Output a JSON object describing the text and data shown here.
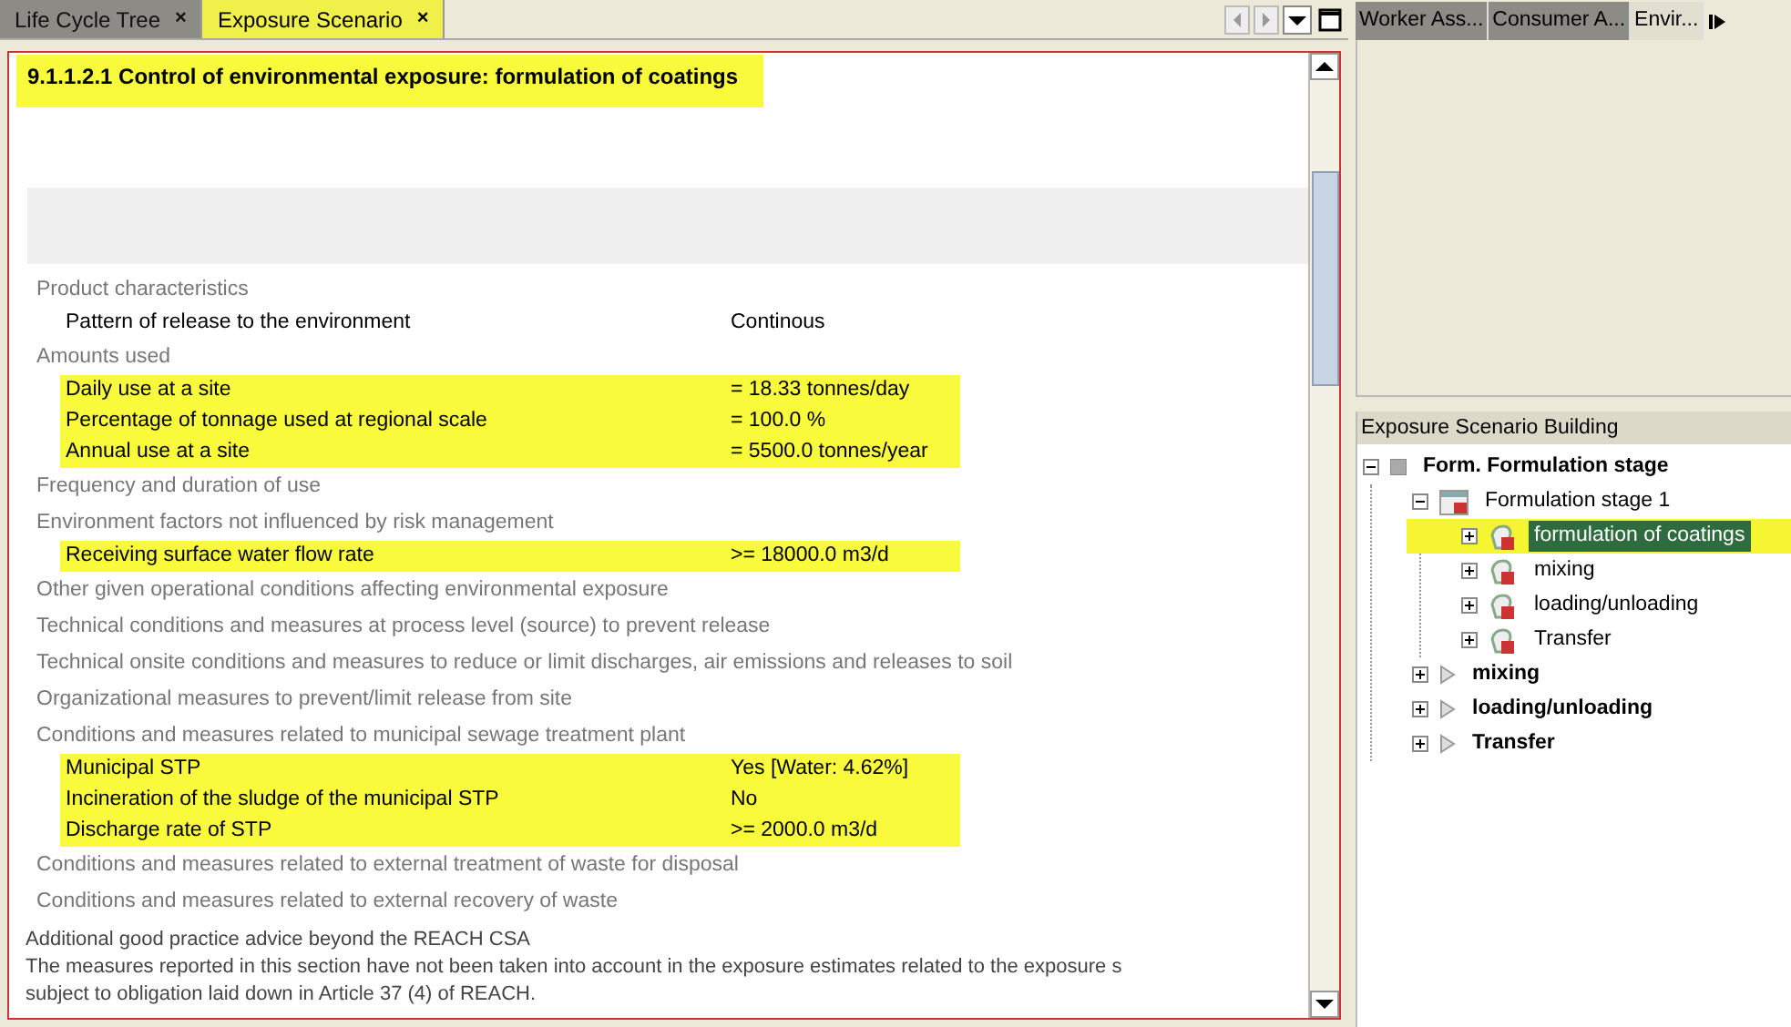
{
  "editor_tabs": [
    {
      "label": "Life Cycle Tree",
      "close": "×",
      "selected": false
    },
    {
      "label": "Exposure Scenario",
      "close": "×",
      "selected": true
    }
  ],
  "document": {
    "title": "9.1.1.2.1 Control of environmental exposure: formulation of coatings",
    "title_highlighted": true,
    "items": [
      {
        "kind": "heading",
        "text": "Product characteristics"
      },
      {
        "kind": "row",
        "label": "Pattern of release to the environment",
        "value": "Continous",
        "highlighted": false
      },
      {
        "kind": "heading",
        "text": "Amounts used"
      },
      {
        "kind": "row",
        "label": "Daily use at a site",
        "value": "= 18.33 tonnes/day",
        "highlighted": true
      },
      {
        "kind": "row",
        "label": "Percentage of tonnage used at regional scale",
        "value": "= 100.0 %",
        "highlighted": true
      },
      {
        "kind": "row",
        "label": "Annual use at a site",
        "value": "= 5500.0 tonnes/year",
        "highlighted": true
      },
      {
        "kind": "heading",
        "text": "Frequency and duration of use"
      },
      {
        "kind": "heading",
        "text": "Environment factors not influenced by risk management"
      },
      {
        "kind": "row",
        "label": "Receiving surface water flow rate",
        "value": ">= 18000.0 m3/d",
        "highlighted": true
      },
      {
        "kind": "heading",
        "text": "Other given operational conditions affecting environmental exposure"
      },
      {
        "kind": "heading",
        "text": "Technical conditions and measures at process level (source) to prevent release"
      },
      {
        "kind": "heading",
        "text": "Technical onsite conditions and measures to reduce or limit discharges, air emissions and releases to soil"
      },
      {
        "kind": "heading",
        "text": "Organizational measures to prevent/limit release from site"
      },
      {
        "kind": "heading",
        "text": "Conditions and measures related to municipal sewage treatment plant"
      },
      {
        "kind": "row",
        "label": "Municipal STP",
        "value": "Yes [Water: 4.62%]",
        "highlighted": true
      },
      {
        "kind": "row",
        "label": "Incineration of the sludge of the municipal STP",
        "value": "No",
        "highlighted": true
      },
      {
        "kind": "row",
        "label": "Discharge rate of STP",
        "value": ">= 2000.0 m3/d",
        "highlighted": true
      },
      {
        "kind": "heading",
        "text": "Conditions and measures related to external treatment of waste for disposal"
      },
      {
        "kind": "heading",
        "text": "Conditions and measures related to external recovery of waste"
      },
      {
        "kind": "note",
        "lines": [
          "Additional good practice advice beyond the REACH CSA",
          "The measures reported in this section have not been taken into account in the exposure estimates related to the exposure s",
          "subject to obligation laid down in Article 37 (4) of REACH."
        ]
      }
    ]
  },
  "side_tabs": [
    {
      "label": "Worker Ass...",
      "selected": false
    },
    {
      "label": "Consumer A...",
      "selected": false
    },
    {
      "label": "Envir...",
      "selected": true
    }
  ],
  "tree": {
    "title": "Exposure Scenario Building",
    "items": [
      {
        "kind": "group",
        "label": "Form. Formulation stage",
        "expanded": true,
        "selected": false,
        "children": [
          {
            "kind": "stage",
            "label": "Formulation stage  1",
            "expanded": true,
            "selected": false,
            "children": [
              {
                "kind": "activity",
                "label": "formulation of coatings",
                "expanded": false,
                "selected": true
              },
              {
                "kind": "activity",
                "label": "mixing",
                "expanded": false,
                "selected": false
              },
              {
                "kind": "activity",
                "label": "loading/unloading",
                "expanded": false,
                "selected": false
              },
              {
                "kind": "activity",
                "label": "Transfer",
                "expanded": false,
                "selected": false
              }
            ]
          },
          {
            "kind": "scenario",
            "label": "mixing",
            "expanded": false,
            "selected": false
          },
          {
            "kind": "scenario",
            "label": "loading/unloading",
            "expanded": false,
            "selected": false
          },
          {
            "kind": "scenario",
            "label": "Transfer",
            "expanded": false,
            "selected": false
          }
        ]
      }
    ]
  }
}
